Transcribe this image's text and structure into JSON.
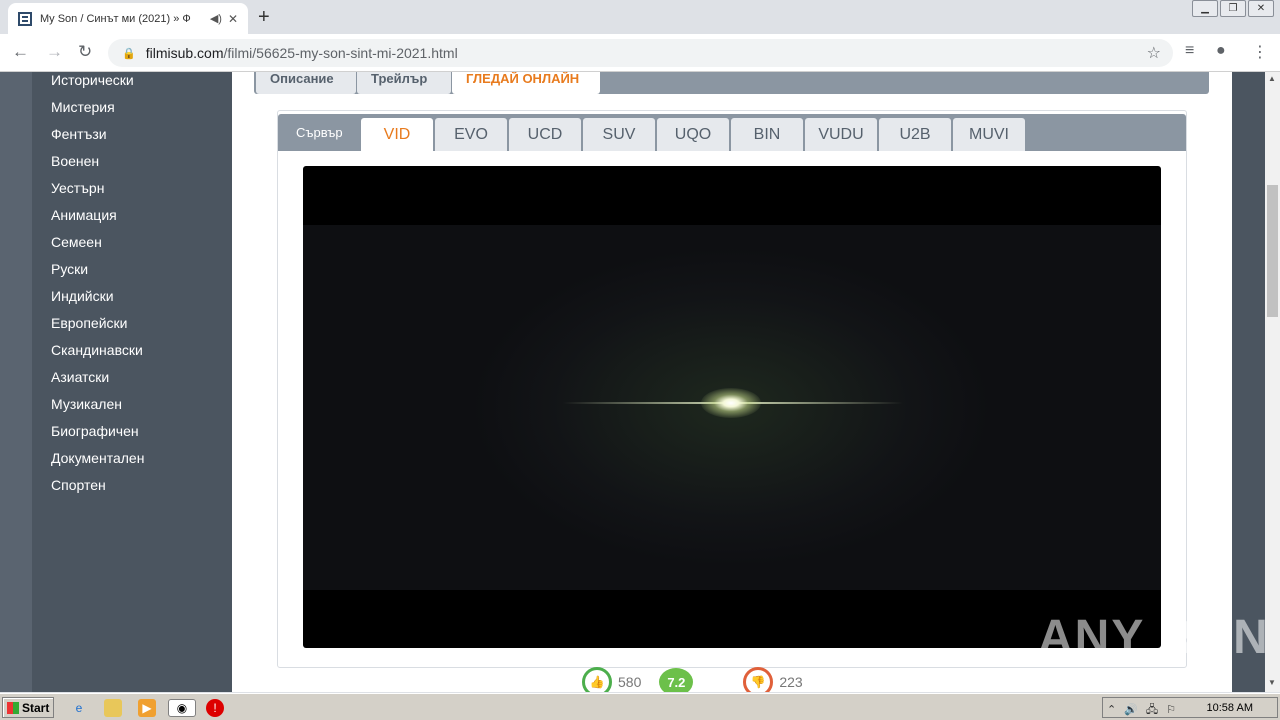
{
  "browser": {
    "tab_title": "My Son / Синът ми (2021) » Ф",
    "url_host": "filmisub.com",
    "url_path": "/filmi/56625-my-son-sint-mi-2021.html"
  },
  "sidebar": {
    "items": [
      "Исторически",
      "Мистерия",
      "Фентъзи",
      "Военен",
      "Уестърн",
      "Анимация",
      "Семеен",
      "Руски",
      "Индийски",
      "Европейски",
      "Скандинавски",
      "Азиатски",
      "Музикален",
      "Биографичен",
      "Документален",
      "Спортен"
    ]
  },
  "menu": {
    "tabs": [
      "Описание",
      "Трейлър",
      "ГЛЕДАЙ ОНЛАЙН"
    ]
  },
  "servers": {
    "label": "Сървър",
    "items": [
      "VID",
      "EVO",
      "UCD",
      "SUV",
      "UQO",
      "BIN",
      "VUDU",
      "U2B",
      "MUVI"
    ]
  },
  "rating": {
    "likes": "580",
    "score": "7.2",
    "dislikes": "223"
  },
  "watermark": "ANY RUN",
  "taskbar": {
    "start_label": "Start",
    "clock": "10:58 AM"
  },
  "colors": {
    "accent": "#e87b1e",
    "sidebar": "#4b5560",
    "tab_bar": "#8b96a2"
  }
}
